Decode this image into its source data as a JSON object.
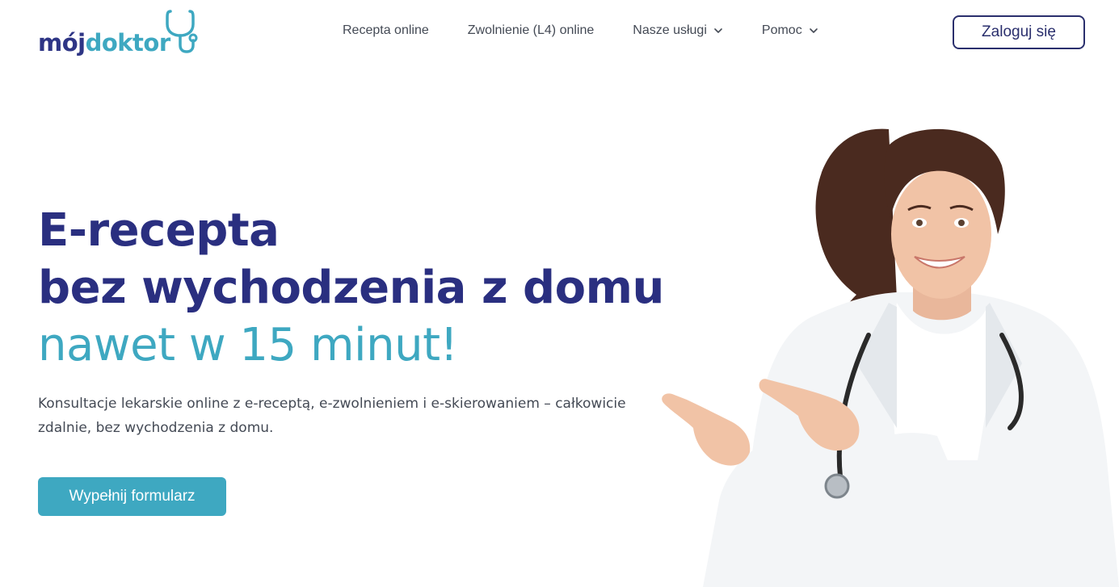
{
  "header": {
    "logo": {
      "part1": "mój",
      "part2": "doktor"
    },
    "nav": [
      {
        "label": "Recepta online",
        "has_dropdown": false
      },
      {
        "label": "Zwolnienie (L4) online",
        "has_dropdown": false
      },
      {
        "label": "Nasze usługi",
        "has_dropdown": true
      },
      {
        "label": "Pomoc",
        "has_dropdown": true
      }
    ],
    "login_label": "Zaloguj się"
  },
  "hero": {
    "line1": "E-recepta",
    "line2": "bez wychodzenia z domu",
    "line3": "nawet w 15 minut!",
    "description": "Konsultacje lekarskie online z e-receptą, e-zwolnieniem i e-skierowaniem – całkowicie zdalnie, bez wychodzenia z domu.",
    "cta_label": "Wypełnij formularz"
  },
  "icons": [
    "stethoscope-icon",
    "chevron-down-icon"
  ],
  "colors": {
    "brand_navy": "#2a2f80",
    "brand_teal": "#3ea8c1",
    "text_gray": "#444a55"
  }
}
